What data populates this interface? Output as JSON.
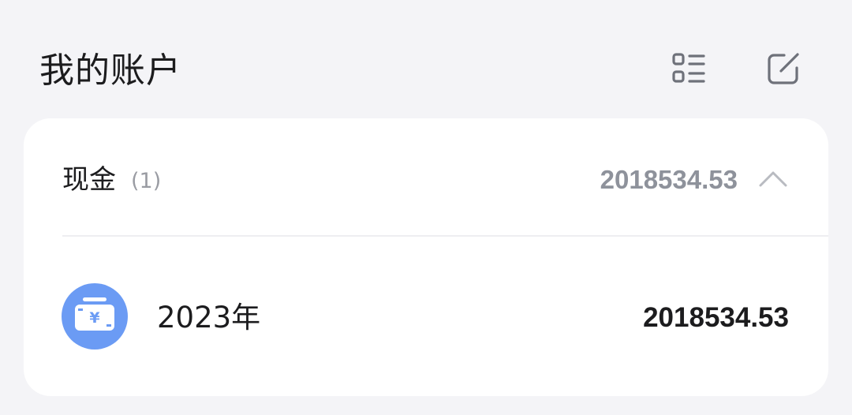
{
  "header": {
    "title": "我的账户",
    "list_icon": "list-view-icon",
    "edit_icon": "edit-icon"
  },
  "groups": [
    {
      "name": "现金",
      "count": "(1)",
      "total": "2018534.53",
      "expanded": true,
      "toggle_icon": "chevron-up-icon",
      "accounts": [
        {
          "name": "2023年",
          "balance": "2018534.53",
          "icon": "cash-yuan-icon"
        }
      ]
    }
  ],
  "colors": {
    "background": "#f4f4f7",
    "card": "#ffffff",
    "icon_accent": "#6b9bf4",
    "muted_text": "#8e929b",
    "text": "#1c1c1e"
  }
}
